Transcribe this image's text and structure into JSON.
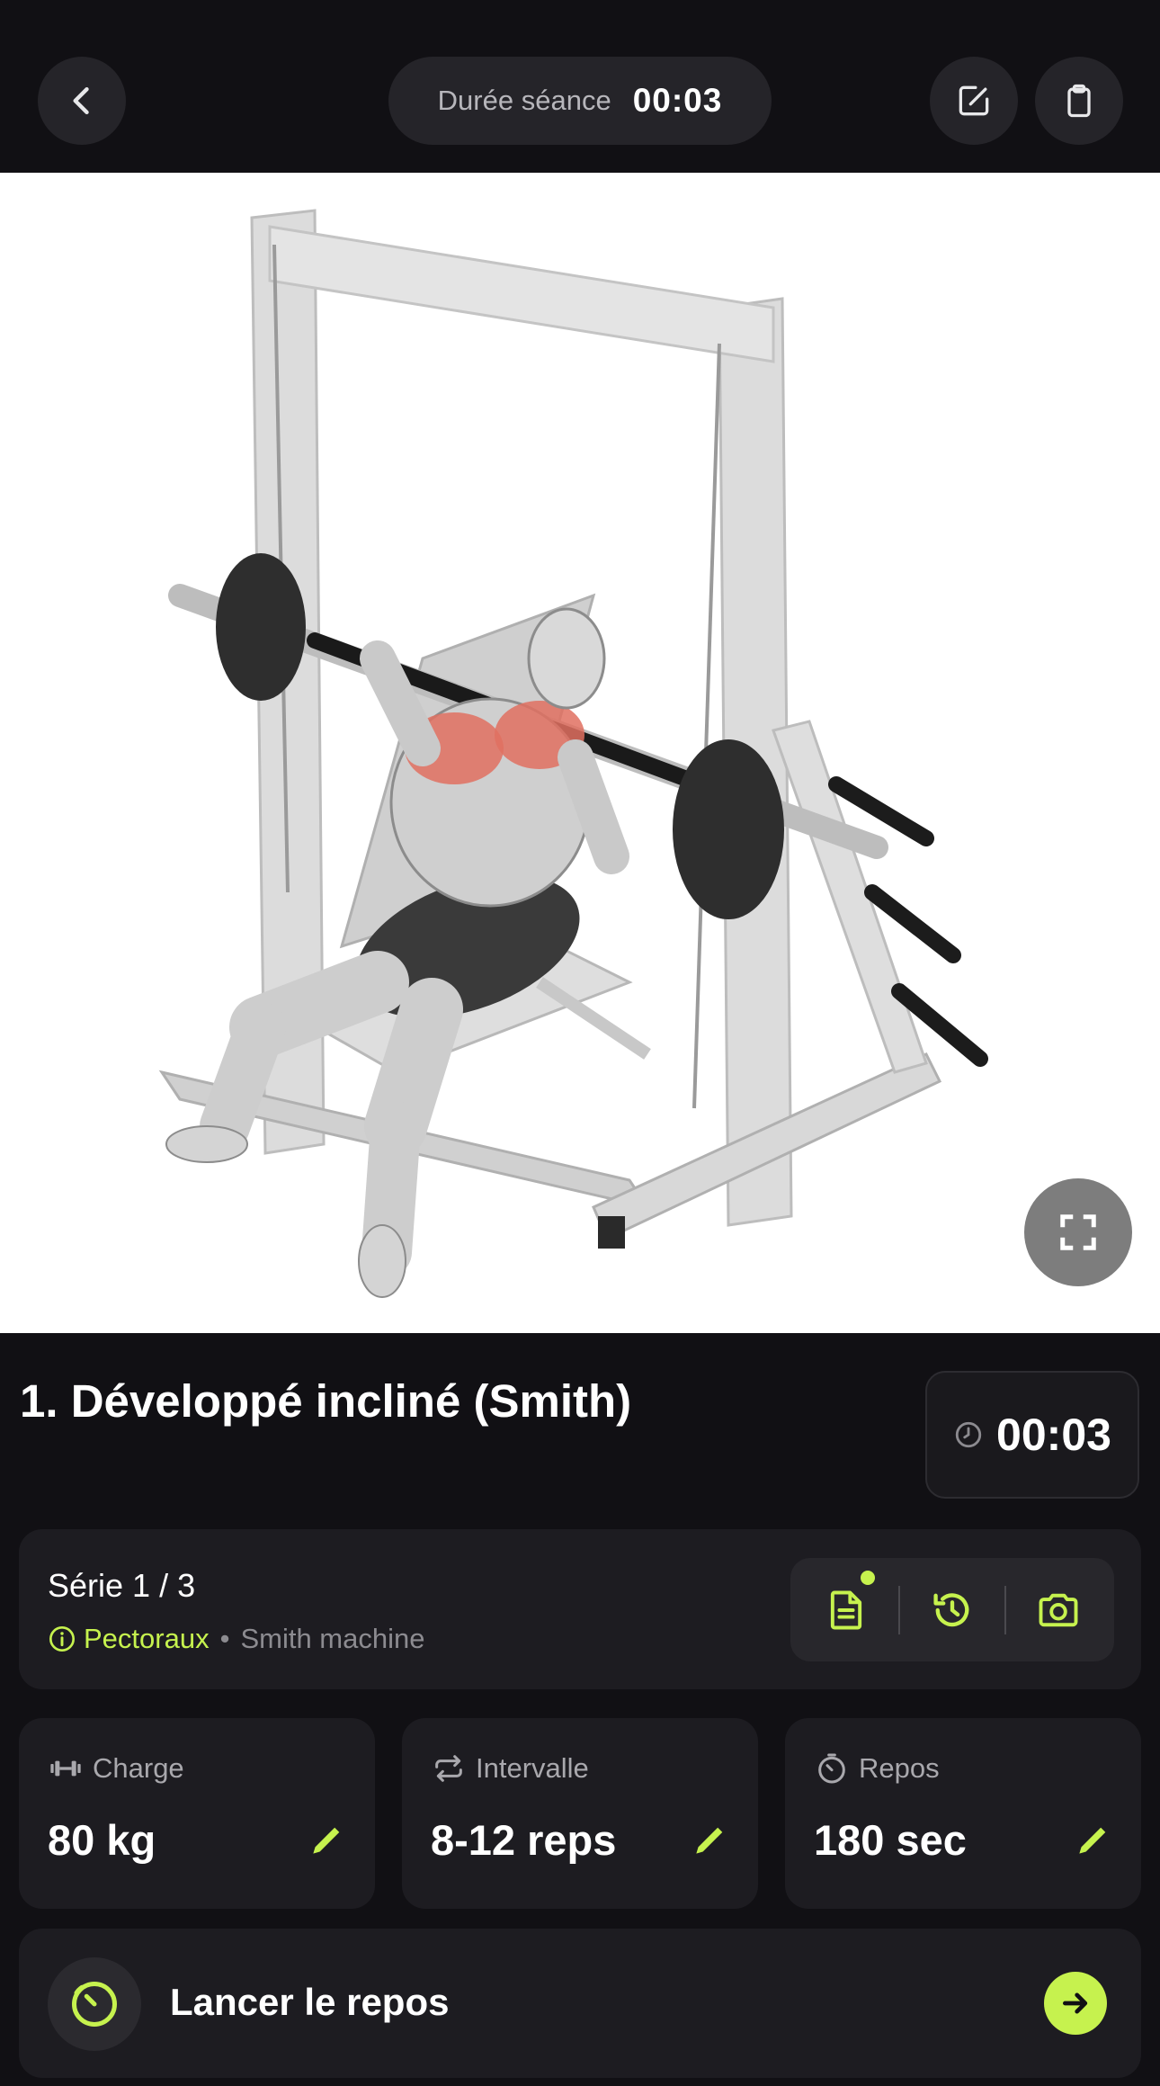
{
  "header": {
    "session_label": "Durée séance",
    "session_time": "00:03",
    "icons": [
      "chevron-left-icon",
      "edit-note-icon",
      "clipboard-icon"
    ]
  },
  "exercise": {
    "title": "1. Développé incliné (Smith)",
    "timer": "00:03"
  },
  "series": {
    "title": "Série 1 / 3",
    "muscle": "Pectoraux",
    "separator": "•",
    "equipment": "Smith machine",
    "tools": [
      "notes-icon",
      "history-icon",
      "camera-icon"
    ]
  },
  "stats": [
    {
      "label": "Charge",
      "value": "80 kg",
      "icon": "dumbbell-icon"
    },
    {
      "label": "Intervalle",
      "value": "8-12 reps",
      "icon": "repeat-icon"
    },
    {
      "label": "Repos",
      "value": "180 sec",
      "icon": "stopwatch-icon"
    }
  ],
  "rest_button": {
    "label": "Lancer le repos"
  },
  "colors": {
    "accent": "#c6f24e",
    "background": "#111014",
    "card": "#1d1c21",
    "muscle_highlight": "#e07060"
  }
}
